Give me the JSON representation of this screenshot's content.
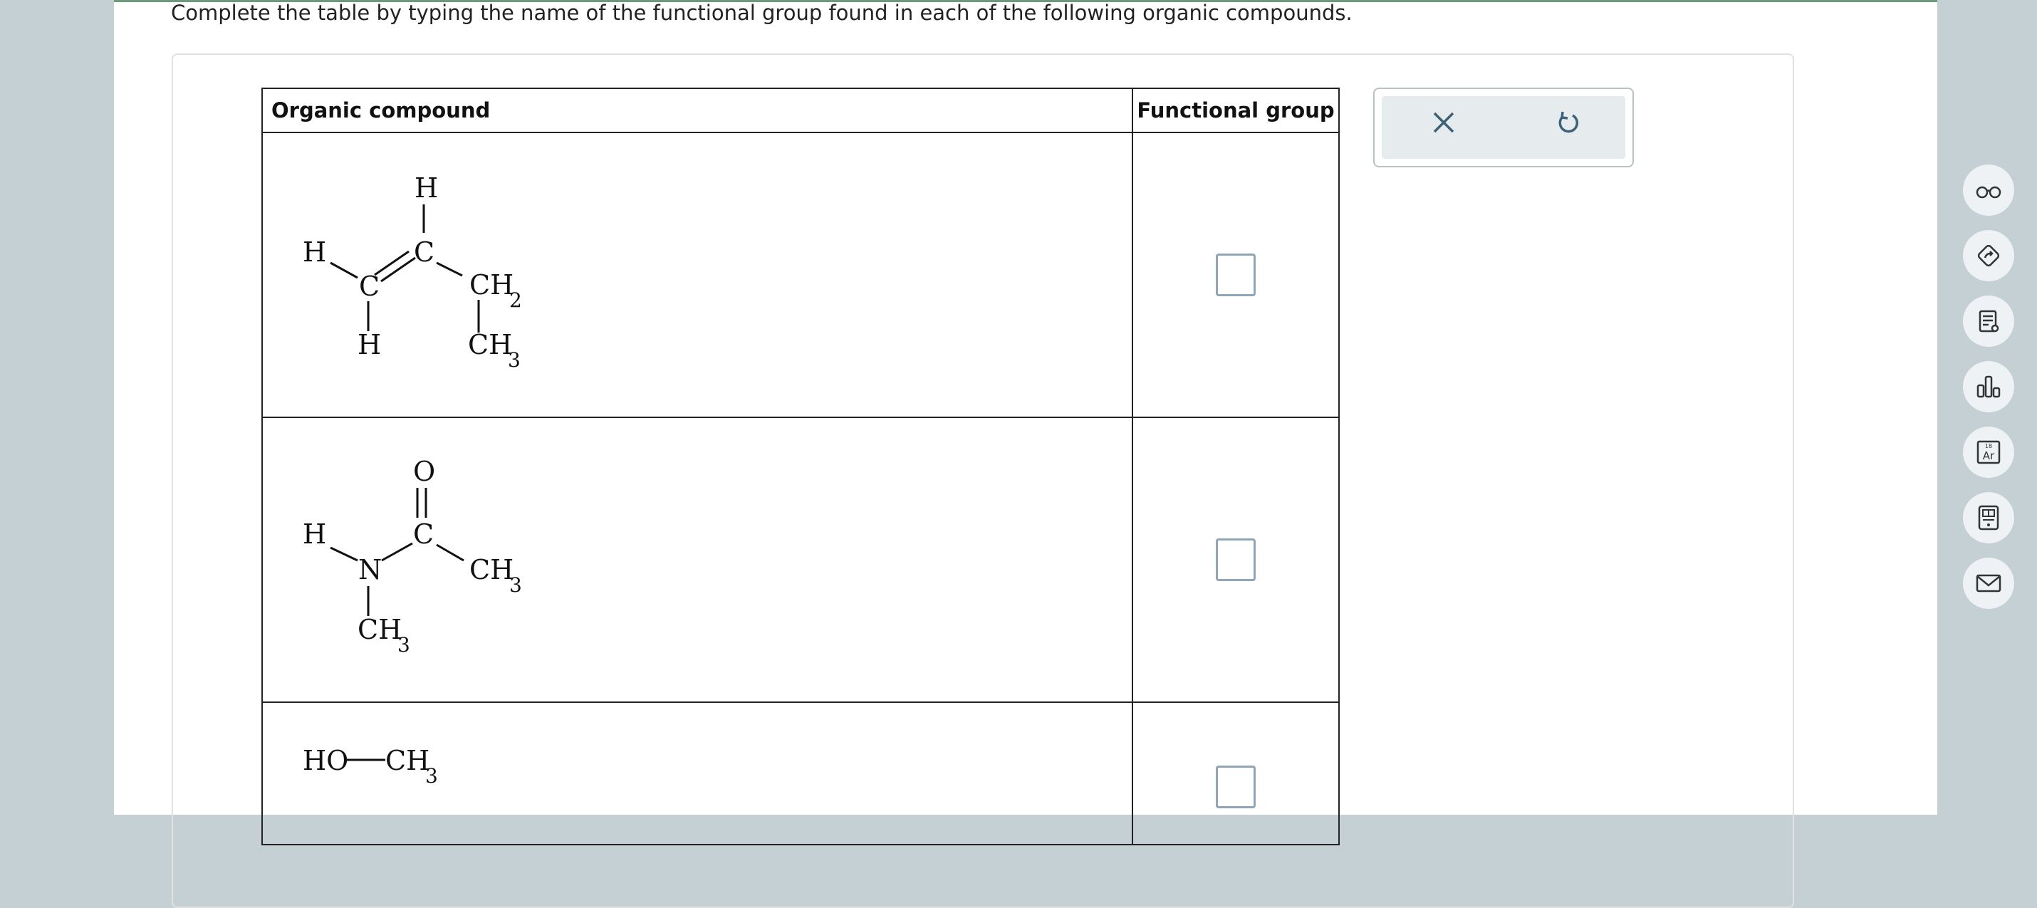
{
  "instruction": "Complete the table by typing the name of the functional group found in each of the following organic compounds.",
  "table": {
    "headers": {
      "compound": "Organic compound",
      "group": "Functional group"
    },
    "rows": [
      {
        "labels": {
          "h_top": "H",
          "c1": "C",
          "h_left": "H",
          "c2": "C",
          "ch2": "CH",
          "ch2_sub": "2",
          "h_bottom": "H",
          "ch3": "CH",
          "ch3_sub": "3"
        },
        "answer": ""
      },
      {
        "labels": {
          "o": "O",
          "c": "C",
          "h": "H",
          "n": "N",
          "ch3_right": "CH",
          "ch3_right_sub": "3",
          "ch3_bottom": "CH",
          "ch3_bottom_sub": "3"
        },
        "answer": ""
      },
      {
        "labels": {
          "ho": "HO",
          "ch3": "CH",
          "ch3_sub": "3"
        },
        "answer": ""
      }
    ]
  },
  "actions": {
    "clear_icon": "close-icon",
    "undo_icon": "undo-icon"
  },
  "toolbar": {
    "icons": [
      "glasses-icon",
      "tag-icon",
      "document-icon",
      "bar-chart-icon",
      "periodic-table-icon",
      "calculator-icon",
      "mail-icon"
    ],
    "periodic_number": "18",
    "periodic_symbol": "Ar"
  },
  "colors": {
    "top_border": "#6c9a7a",
    "side_background": "#c5d0d4",
    "answer_box_border": "#8ea6b8",
    "action_bg": "#e6ebee"
  }
}
